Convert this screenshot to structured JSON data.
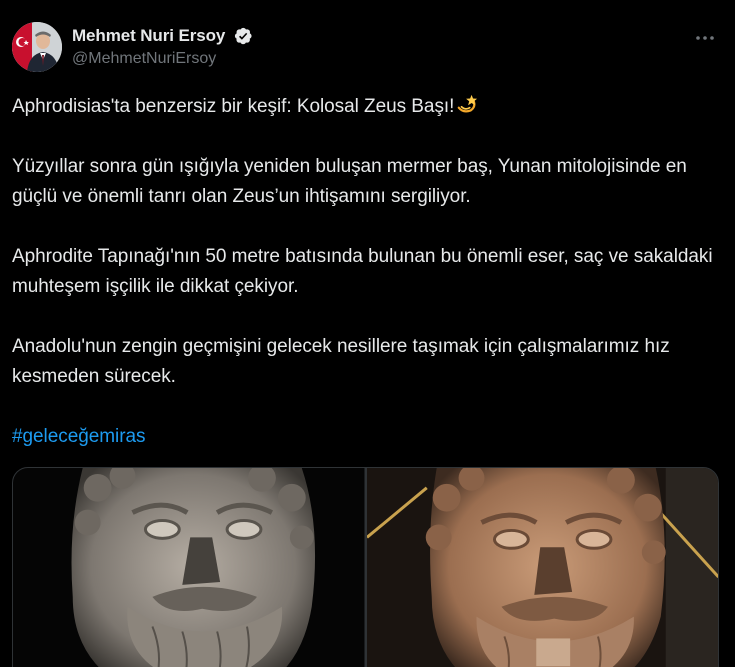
{
  "author": {
    "display_name": "Mehmet Nuri Ersoy",
    "handle": "@MehmetNuriErsoy",
    "verified": true,
    "avatar_icon": "profile-photo-with-flag"
  },
  "more_icon": "more-dots-icon",
  "tweet": {
    "paragraphs": [
      "Aphrodisias'ta benzersiz bir keşif: Kolosal Zeus Başı!",
      "Yüzyıllar sonra gün ışığıyla yeniden buluşan mermer baş, Yunan mitolojisinde en güçlü ve önemli tanrı olan Zeus’un ihtişamını sergiliyor.",
      "Aphrodite Tapınağı'nın 50 metre batısında bulunan bu önemli eser, saç ve sakaldaki muhteşem işçilik ile dikkat çekiyor.",
      "Anadolu'nun zengin geçmişini gelecek nesillere taşımak için çalışmalarımız hız kesmeden sürecek."
    ],
    "hashtag": "#geleceğemiras",
    "emoji": "dizzy-star-emoji"
  },
  "media": [
    {
      "name": "zeus-head-photo-grey",
      "tone": "#8f8a82"
    },
    {
      "name": "zeus-head-photo-warm",
      "tone": "#a87b5c"
    }
  ],
  "colors": {
    "background": "#000000",
    "text": "#e7e9ea",
    "secondary": "#71767b",
    "accent": "#1d9bf0"
  }
}
